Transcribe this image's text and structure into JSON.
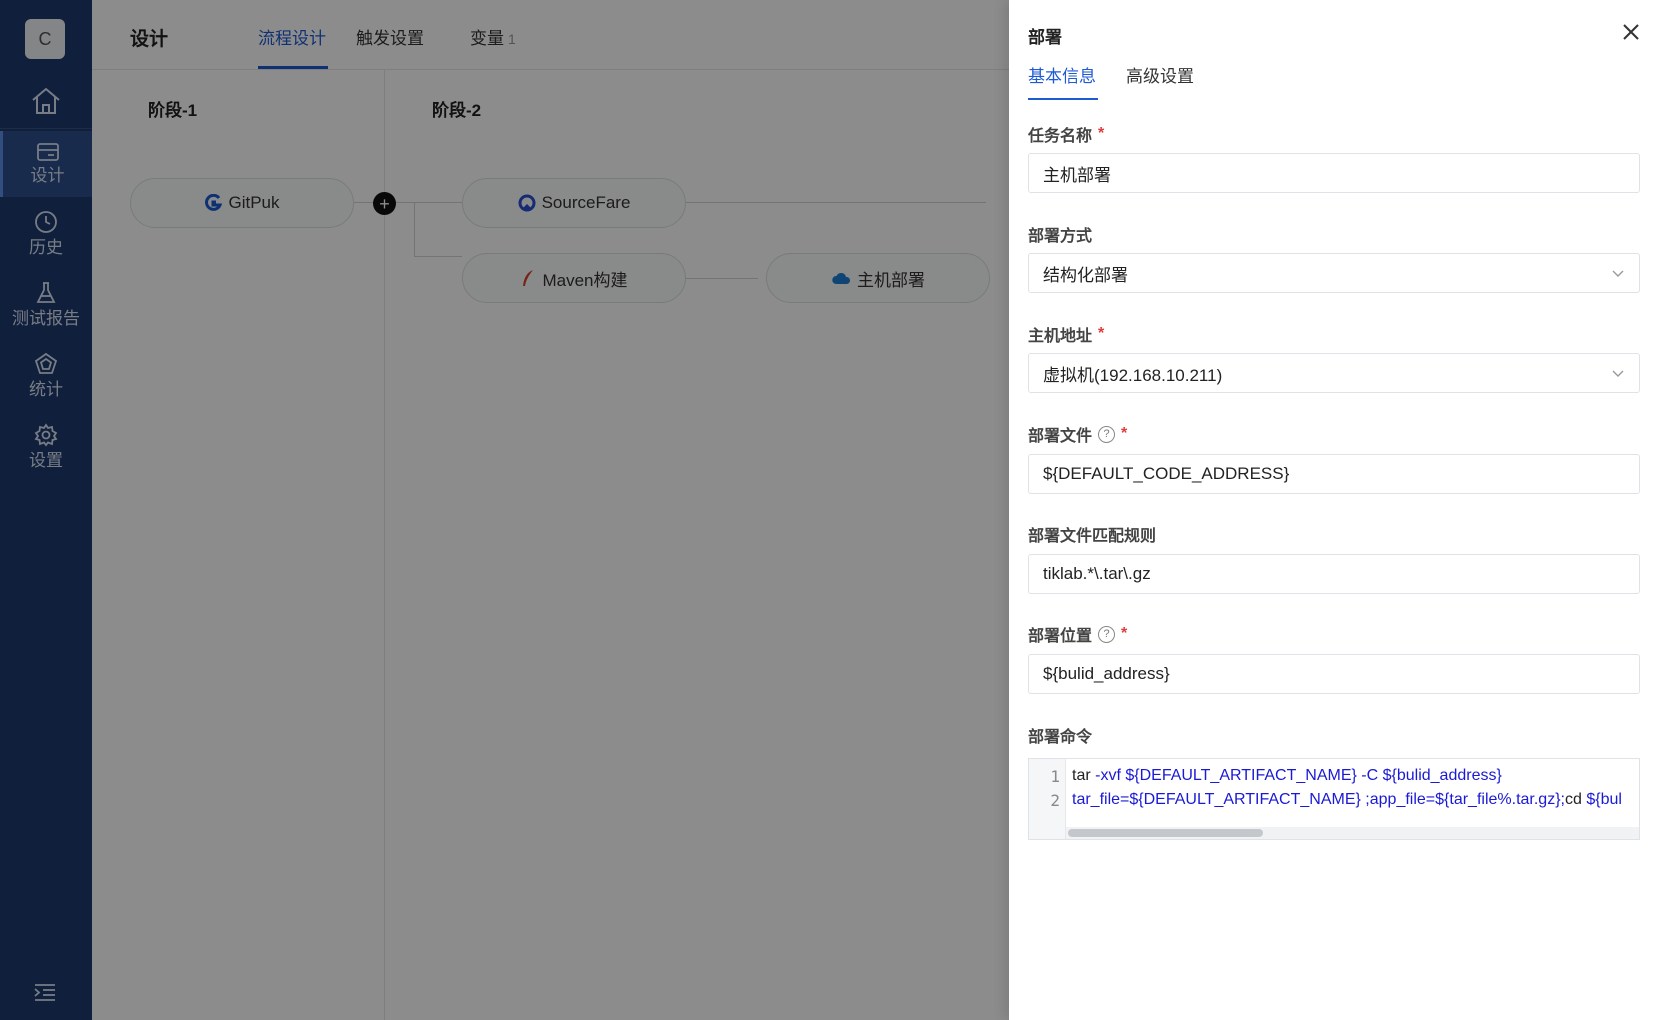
{
  "sidebar": {
    "avatar": "C",
    "nav": [
      {
        "label": "设计",
        "icon": "design-icon",
        "active": true
      },
      {
        "label": "历史",
        "icon": "clock-icon",
        "active": false
      },
      {
        "label": "测试报告",
        "icon": "flask-icon",
        "active": false
      },
      {
        "label": "统计",
        "icon": "stats-icon",
        "active": false
      },
      {
        "label": "设置",
        "icon": "gear-icon",
        "active": false
      }
    ]
  },
  "header": {
    "title": "设计",
    "tabs": [
      {
        "label": "流程设计",
        "active": true
      },
      {
        "label": "触发设置",
        "active": false
      },
      {
        "label": "变量",
        "count": "1",
        "active": false
      }
    ]
  },
  "stages": [
    {
      "title": "阶段-1",
      "tasks": [
        {
          "name": "GitPuk",
          "icon": "gitpuk-icon"
        }
      ]
    },
    {
      "title": "阶段-2",
      "tasks": [
        {
          "name": "SourceFare",
          "icon": "sourcefare-icon"
        },
        {
          "name": "Maven构建",
          "icon": "maven-icon"
        },
        {
          "name": "主机部署",
          "icon": "cloud-deploy-icon"
        }
      ]
    }
  ],
  "drawer": {
    "title": "部署",
    "tabs": [
      {
        "label": "基本信息",
        "active": true
      },
      {
        "label": "高级设置",
        "active": false
      }
    ],
    "fields": {
      "task_name": {
        "label": "任务名称",
        "value": "主机部署",
        "required": true
      },
      "deploy_mode": {
        "label": "部署方式",
        "value": "结构化部署"
      },
      "host": {
        "label": "主机地址",
        "value": "虚拟机(192.168.10.211)",
        "required": true
      },
      "deploy_file": {
        "label": "部署文件",
        "value": "${DEFAULT_CODE_ADDRESS}",
        "required": true
      },
      "match_rule": {
        "label": "部署文件匹配规则",
        "value": "tiklab.*\\.tar\\.gz"
      },
      "deploy_location": {
        "label": "部署位置",
        "value": "${bulid_address}",
        "required": true
      },
      "deploy_command": {
        "label": "部署命令",
        "lines": [
          {
            "no": "1",
            "plain": "tar ",
            "code": "-xvf  ${DEFAULT_ARTIFACT_NAME} -C ${bulid_address}"
          },
          {
            "no": "2",
            "plain": "",
            "code": "tar_file=${DEFAULT_ARTIFACT_NAME} ;app_file=${tar_file%.tar.gz};",
            "plain2": "cd ",
            "code2": "${bul"
          }
        ]
      }
    },
    "required_mark": "*",
    "help_mark": "?"
  }
}
